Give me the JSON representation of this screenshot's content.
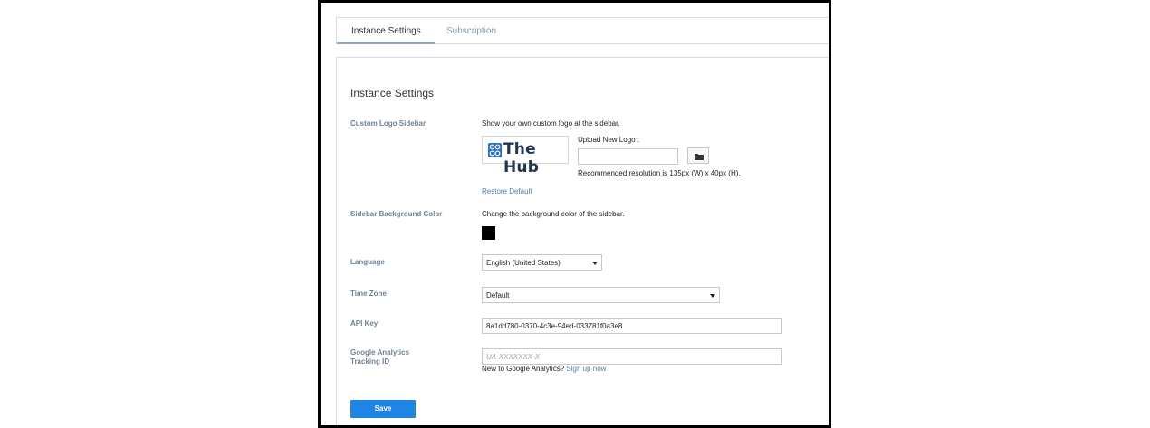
{
  "tabs": [
    {
      "label": "Instance Settings",
      "active": true
    },
    {
      "label": "Subscription",
      "active": false
    }
  ],
  "panel": {
    "title": "Instance Settings"
  },
  "custom_logo": {
    "label": "Custom Logo Sidebar",
    "description": "Show your own custom logo at the sidebar.",
    "logo_text": "The Hub",
    "upload_label": "Upload New Logo :",
    "recommendation": "Recommended resolution is 135px (W) x 40px (H).",
    "restore_link": "Restore Default",
    "upload_icon": "folder-icon"
  },
  "sidebar_color": {
    "label": "Sidebar Background Color",
    "description": "Change the background color of the sidebar.",
    "color": "#000000"
  },
  "language": {
    "label": "Language",
    "selected": "English (United States)"
  },
  "timezone": {
    "label": "Time Zone",
    "selected": "Default"
  },
  "api_key": {
    "label": "API Key",
    "value": "8a1dd780-0370-4c3e-94ed-033781f0a3e8"
  },
  "analytics": {
    "label": "Google Analytics Tracking ID",
    "placeholder": "UA-XXXXXXX-X",
    "prompt": "New to Google Analytics?",
    "signup_link": "Sign up now"
  },
  "save_label": "Save",
  "colors": {
    "accent": "#1f86e8",
    "label": "#6e8196",
    "link": "#4a7fb8",
    "logo_blue": "#2a6fcf"
  }
}
